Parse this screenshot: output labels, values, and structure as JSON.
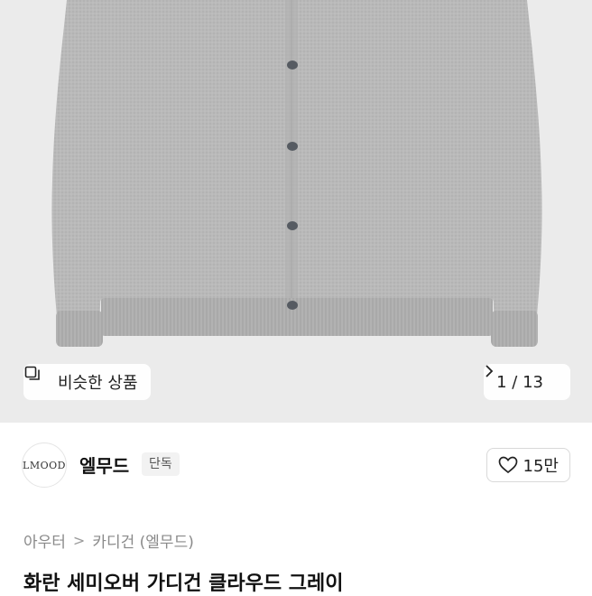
{
  "hero": {
    "similar_label": "비슷한 상품",
    "counter": "1 / 13",
    "icons": {
      "similar": "similar-items-icon",
      "next": "chevron-right-icon"
    },
    "colors": {
      "background": "#ebebeb",
      "knit": "#b7b7b7",
      "button": "#555a60"
    }
  },
  "brand": {
    "logo_text": "LMOOD",
    "name": "엘무드",
    "badge": "단독",
    "likes": "15만",
    "like_icon": "heart-icon"
  },
  "breadcrumb": {
    "category": "아우터",
    "separator": ">",
    "subcategory": "카디건 (엘무드)"
  },
  "product": {
    "title": "화란 세미오버 가디건 클라우드 그레이"
  }
}
